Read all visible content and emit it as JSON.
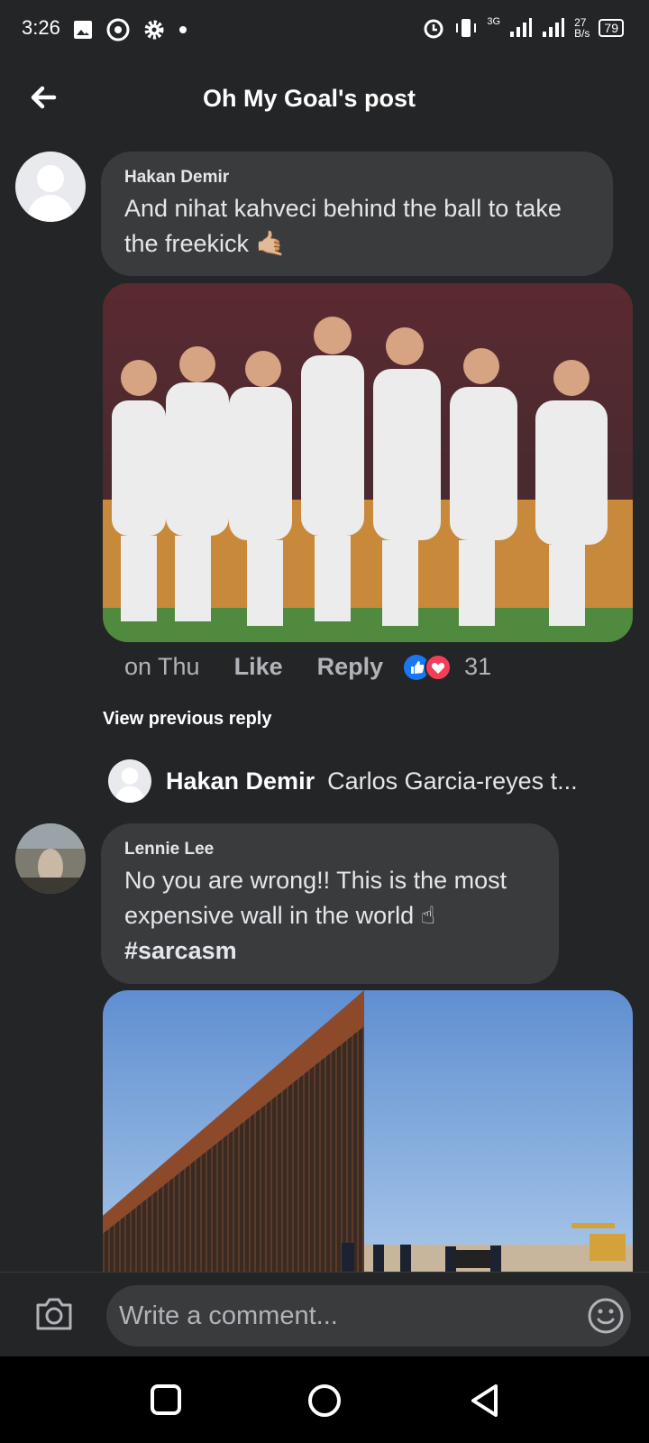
{
  "status": {
    "time": "3:26",
    "net_type": "3G",
    "speed_value": "27",
    "speed_unit": "B/s",
    "battery": "79"
  },
  "header": {
    "title": "Oh My Goal's post"
  },
  "comments": [
    {
      "author": "Hakan Demir",
      "text": "And nihat kahveci behind the ball to take the freekick 🤙🏼"
    },
    {
      "author": "Lennie Lee",
      "text": "No you are wrong!! This is the most expensive wall in the world ☝",
      "hashtag": "#sarcasm"
    }
  ],
  "meta": {
    "time": "on Thu",
    "like": "Like",
    "reply": "Reply",
    "reactions_count": "31"
  },
  "replies": {
    "view_previous": "View previous reply",
    "author": "Hakan Demir",
    "preview": "Carlos Garcia-reyes t..."
  },
  "composer": {
    "placeholder": "Write a comment..."
  },
  "colors": {
    "bg": "#242527",
    "bubble": "#3a3b3d",
    "like_blue": "#1877f2",
    "love_red": "#f33e58"
  }
}
